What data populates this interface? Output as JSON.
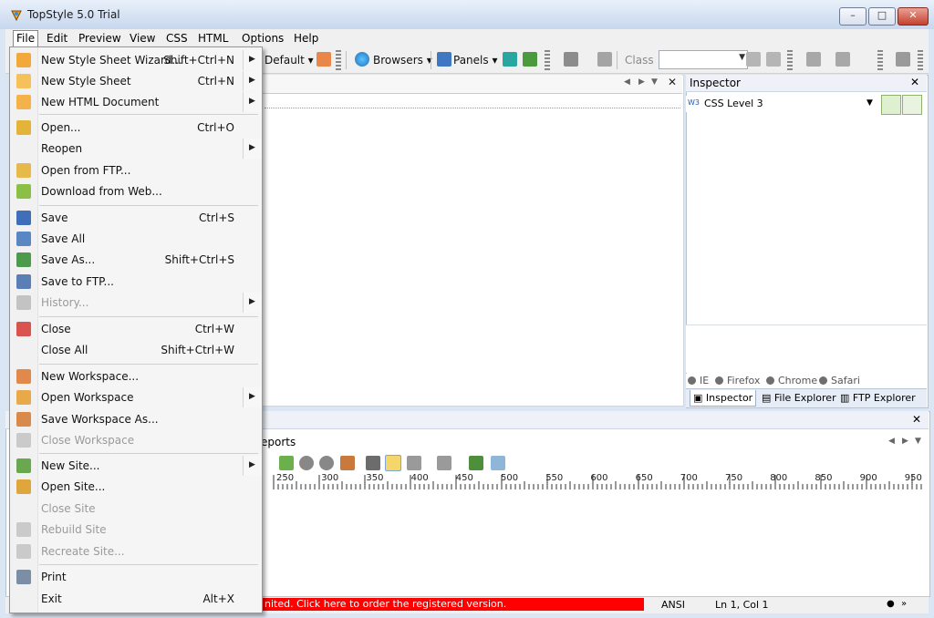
{
  "window": {
    "title": "TopStyle 5.0 Trial"
  },
  "menubar": [
    {
      "label": "File"
    },
    {
      "label": "Edit"
    },
    {
      "label": "Preview"
    },
    {
      "label": "View"
    },
    {
      "label": "CSS"
    },
    {
      "label": "HTML"
    },
    {
      "label": "Options"
    },
    {
      "label": "Help"
    }
  ],
  "toolbar": {
    "default_label": "Default",
    "browsers_label": "Browsers",
    "panels_label": "Panels",
    "class_label": "Class",
    "class_value": ""
  },
  "file_menu": {
    "items": [
      {
        "label": "New Style Sheet Wizard...",
        "shortcut": "Shift+Ctrl+N",
        "submenu": true,
        "icon": "wizard-icon",
        "color": "#f2a93b"
      },
      {
        "label": "New Style Sheet",
        "shortcut": "Ctrl+N",
        "submenu": true,
        "icon": "stylesheet-icon",
        "color": "#f6c15a"
      },
      {
        "label": "New HTML Document",
        "shortcut": "",
        "submenu": true,
        "icon": "html-document-icon",
        "color": "#f3b24a"
      },
      {
        "label": "Open...",
        "shortcut": "Ctrl+O",
        "submenu": false,
        "icon": "open-folder-icon",
        "color": "#e4b33a"
      },
      {
        "label": "Reopen",
        "shortcut": "",
        "submenu": true,
        "icon": "",
        "color": ""
      },
      {
        "label": "Open from FTP...",
        "shortcut": "",
        "submenu": false,
        "icon": "ftp-folder-icon",
        "color": "#e7b94a"
      },
      {
        "label": "Download from Web...",
        "shortcut": "",
        "submenu": false,
        "icon": "web-download-icon",
        "color": "#8cbf45"
      },
      {
        "label": "Save",
        "shortcut": "Ctrl+S",
        "submenu": false,
        "icon": "save-icon",
        "color": "#3e6fb8"
      },
      {
        "label": "Save All",
        "shortcut": "",
        "submenu": false,
        "icon": "save-all-icon",
        "color": "#5b86c4"
      },
      {
        "label": "Save As...",
        "shortcut": "Shift+Ctrl+S",
        "submenu": false,
        "icon": "save-as-icon",
        "color": "#4c9a4c"
      },
      {
        "label": "Save to FTP...",
        "shortcut": "",
        "submenu": false,
        "icon": "ftp-save-icon",
        "color": "#5a7fb6"
      },
      {
        "label": "History...",
        "shortcut": "",
        "submenu": true,
        "disabled": true,
        "icon": "history-icon",
        "color": "#8b8b8b"
      },
      {
        "label": "Close",
        "shortcut": "Ctrl+W",
        "submenu": false,
        "icon": "close-document-icon",
        "color": "#d9534f"
      },
      {
        "label": "Close All",
        "shortcut": "Shift+Ctrl+W",
        "submenu": false,
        "icon": "",
        "color": ""
      },
      {
        "label": "New Workspace...",
        "shortcut": "",
        "submenu": false,
        "icon": "new-workspace-icon",
        "color": "#e0894a"
      },
      {
        "label": "Open Workspace",
        "shortcut": "",
        "submenu": true,
        "icon": "open-workspace-icon",
        "color": "#e8a94a"
      },
      {
        "label": "Save Workspace As...",
        "shortcut": "",
        "submenu": false,
        "icon": "save-workspace-icon",
        "color": "#d98a4a"
      },
      {
        "label": "Close Workspace",
        "shortcut": "",
        "submenu": false,
        "disabled": true,
        "icon": "close-workspace-icon",
        "color": "#9c9c9c"
      },
      {
        "label": "New Site...",
        "shortcut": "",
        "submenu": true,
        "icon": "new-site-icon",
        "color": "#6aa84f"
      },
      {
        "label": "Open Site...",
        "shortcut": "",
        "submenu": false,
        "icon": "open-site-icon",
        "color": "#e0a63e"
      },
      {
        "label": "Close Site",
        "shortcut": "",
        "submenu": false,
        "disabled": true,
        "icon": "",
        "color": ""
      },
      {
        "label": "Rebuild Site",
        "shortcut": "",
        "submenu": false,
        "disabled": true,
        "icon": "rebuild-site-icon",
        "color": "#9c9c9c"
      },
      {
        "label": "Recreate Site...",
        "shortcut": "",
        "submenu": false,
        "disabled": true,
        "icon": "recreate-site-icon",
        "color": "#9c9c9c"
      },
      {
        "label": "Print",
        "shortcut": "",
        "submenu": false,
        "icon": "print-icon",
        "color": "#7a8ea8"
      },
      {
        "label": "Exit",
        "shortcut": "Alt+X",
        "submenu": false,
        "icon": "",
        "color": ""
      }
    ]
  },
  "inspector": {
    "title": "Inspector",
    "level_label": "CSS Level 3",
    "browsers": [
      {
        "label": "IE"
      },
      {
        "label": "Firefox"
      },
      {
        "label": "Chrome"
      },
      {
        "label": "Safari"
      }
    ],
    "tabs": [
      {
        "label": "Inspector"
      },
      {
        "label": "File Explorer"
      },
      {
        "label": "FTP Explorer"
      }
    ]
  },
  "bottom_panel": {
    "tab_label": "eports",
    "ruler_labels": [
      "250",
      "300",
      "350",
      "400",
      "450",
      "500",
      "550",
      "600",
      "650",
      "700",
      "750",
      "800",
      "850",
      "900",
      "950"
    ]
  },
  "statusbar": {
    "trial_message": "nited. Click here to order the registered version.",
    "encoding": "ANSI",
    "position": "Ln 1, Col 1"
  }
}
